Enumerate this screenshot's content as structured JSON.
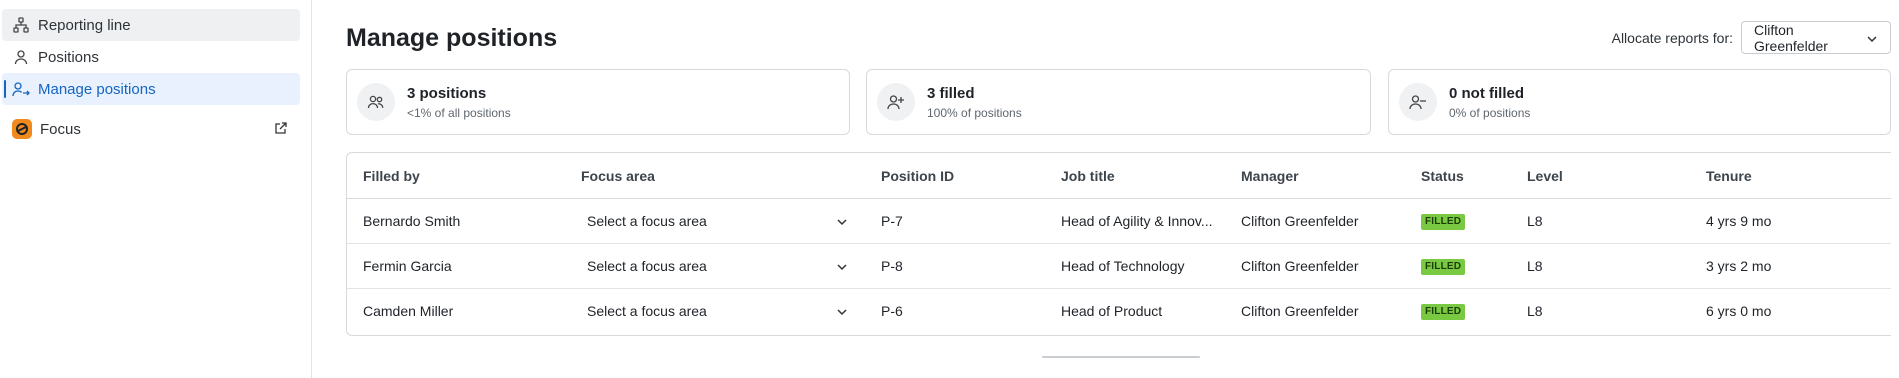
{
  "sidebar": {
    "items": [
      {
        "label": "Reporting line",
        "icon": "hierarchy-icon"
      },
      {
        "label": "Positions",
        "icon": "person-icon"
      },
      {
        "label": "Manage positions",
        "icon": "people-arrow-icon"
      },
      {
        "label": "Focus",
        "icon": "focus-logo-icon"
      }
    ]
  },
  "header": {
    "title": "Manage positions",
    "allocate_label": "Allocate reports for:",
    "allocate_value": "Clifton Greenfelder"
  },
  "summary": [
    {
      "title": "3 positions",
      "subtitle": "<1% of all positions",
      "icon": "people-icon"
    },
    {
      "title": "3 filled",
      "subtitle": "100% of positions",
      "icon": "person-add-icon"
    },
    {
      "title": "0 not filled",
      "subtitle": "0% of positions",
      "icon": "person-remove-icon"
    }
  ],
  "table": {
    "columns": [
      "Filled by",
      "Focus area",
      "Position ID",
      "Job title",
      "Manager",
      "Status",
      "Level",
      "Tenure"
    ],
    "rows": [
      {
        "filled_by": "Bernardo Smith",
        "focus_area": "Select a focus area",
        "position_id": "P-7",
        "job_title": "Head of Agility & Innov...",
        "manager": "Clifton Greenfelder",
        "status": "FILLED",
        "level": "L8",
        "tenure": "4 yrs 9 mo"
      },
      {
        "filled_by": "Fermin Garcia",
        "focus_area": "Select a focus area",
        "position_id": "P-8",
        "job_title": "Head of Technology",
        "manager": "Clifton Greenfelder",
        "status": "FILLED",
        "level": "L8",
        "tenure": "3 yrs 2 mo"
      },
      {
        "filled_by": "Camden Miller",
        "focus_area": "Select a focus area",
        "position_id": "P-6",
        "job_title": "Head of Product",
        "manager": "Clifton Greenfelder",
        "status": "FILLED",
        "level": "L8",
        "tenure": "6 yrs 0 mo"
      }
    ]
  },
  "colors": {
    "accent": "#1565c0",
    "status_filled": "#7ac943",
    "focus_brand": "#f08a1d"
  }
}
